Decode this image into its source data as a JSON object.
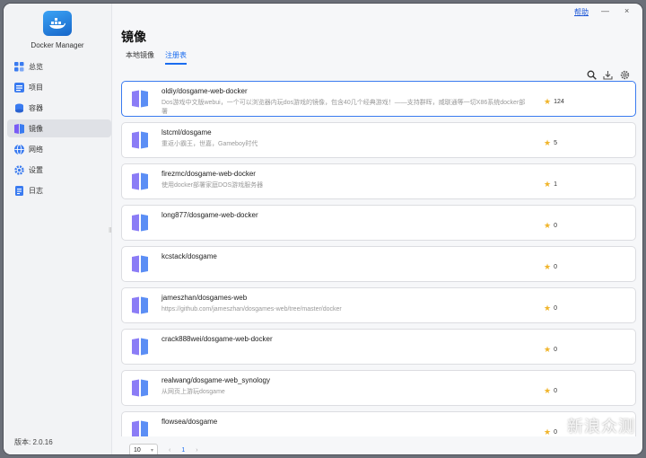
{
  "app": {
    "name": "Docker Manager",
    "version": "版本: 2.0.16"
  },
  "header": {
    "help": "帮助",
    "minimize": "—",
    "close": "×"
  },
  "sidebar": {
    "items": [
      {
        "label": "总览",
        "icon": "grid-icon",
        "active": false
      },
      {
        "label": "项目",
        "icon": "project-icon",
        "active": false
      },
      {
        "label": "容器",
        "icon": "container-icon",
        "active": false
      },
      {
        "label": "镜像",
        "icon": "image-icon",
        "active": true
      },
      {
        "label": "网络",
        "icon": "network-icon",
        "active": false
      },
      {
        "label": "设置",
        "icon": "gear-icon",
        "active": false
      },
      {
        "label": "日志",
        "icon": "log-icon",
        "active": false
      }
    ]
  },
  "main": {
    "title": "镜像",
    "tabs": [
      {
        "label": "本地镜像",
        "active": false
      },
      {
        "label": "注册表",
        "active": true
      }
    ]
  },
  "images": [
    {
      "name": "oldiy/dosgame-web-docker",
      "desc": "Dos游戏中文版webui，一个可以浏览器内玩dos游戏的镜像，包含40几个经典游戏！——支持群晖，威联通等一切X86系统docker部署",
      "stars": "124"
    },
    {
      "name": "lstcml/dosgame",
      "desc": "重返小霸王，世嘉，Gameboy时代",
      "stars": "5"
    },
    {
      "name": "firezmc/dosgame-web-docker",
      "desc": "使用docker部署家庭DOS游戏服务器",
      "stars": "1"
    },
    {
      "name": "long877/dosgame-web-docker",
      "desc": "",
      "stars": "0"
    },
    {
      "name": "kcstack/dosgame",
      "desc": "",
      "stars": "0"
    },
    {
      "name": "jameszhan/dosgames-web",
      "desc": "https://github.com/jameszhan/dosgames-web/tree/master/docker",
      "stars": "0"
    },
    {
      "name": "crack888wei/dosgame-web-docker",
      "desc": "",
      "stars": "0"
    },
    {
      "name": "realwang/dosgame-web_synology",
      "desc": "从网页上游玩dosgame",
      "stars": "0"
    },
    {
      "name": "flowsea/dosgame",
      "desc": "",
      "stars": "0"
    }
  ],
  "pagination": {
    "page_size": "10",
    "prev": "‹",
    "current": "1",
    "next": "›"
  },
  "watermark": "新浪众测",
  "colors": {
    "accent": "#1a6cf0",
    "star": "#f0b429"
  }
}
